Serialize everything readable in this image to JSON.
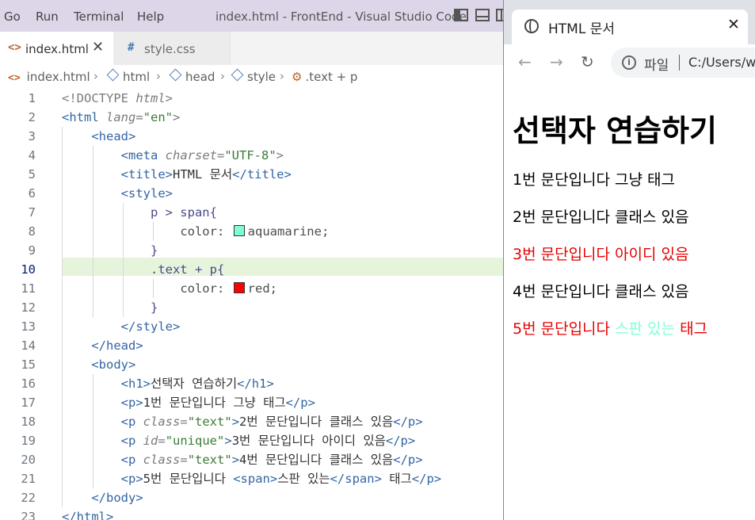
{
  "vscode": {
    "menu": [
      "Go",
      "Run",
      "Terminal",
      "Help"
    ],
    "window_title": "index.html - FrontEnd - Visual Studio Code",
    "tabs": [
      {
        "icon": "html-file-icon",
        "label": "index.html",
        "active": true
      },
      {
        "icon": "css-file-icon",
        "label": "style.css",
        "active": false
      }
    ],
    "breadcrumb": [
      "index.html",
      "html",
      "head",
      "style",
      ".text + p"
    ],
    "current_line": 10,
    "line_numbers": [
      "1",
      "2",
      "3",
      "4",
      "5",
      "6",
      "7",
      "8",
      "9",
      "10",
      "11",
      "12",
      "13",
      "14",
      "15",
      "16",
      "17",
      "18",
      "19",
      "20",
      "21",
      "22",
      "23"
    ],
    "code": {
      "doctype": "<!DOCTYPE",
      "doctype_html": "html",
      "html_open": "<html",
      "lang_attr": "lang",
      "lang_val": "\"en\"",
      "head_open": "<head>",
      "meta": "<meta",
      "charset_attr": "charset",
      "charset_val": "\"UTF-8\"",
      "title_open": "<title>",
      "title_text": "HTML 문서",
      "title_close": "</title>",
      "style_open": "<style>",
      "sel1": "p > span{",
      "prop": "color:",
      "val1": "aquamarine;",
      "val1_color": "#7fffd4",
      "brace_close": "}",
      "sel2": ".text + p{",
      "val2": "red;",
      "val2_color": "#ff0000",
      "style_close": "</style>",
      "head_close": "</head>",
      "body_open": "<body>",
      "h1_open": "<h1>",
      "h1_text": "선택자 연습하기",
      "h1_close": "</h1>",
      "p_open": "<p>",
      "p_close": "</p>",
      "p_tag": "<p",
      "class_attr": "class",
      "id_attr": "id",
      "text_val": "\"text\"",
      "unique_val": "\"unique\"",
      "p1_text": "1번 문단입니다 그냥 태그",
      "p2_text": "2번 문단입니다 클래스 있음",
      "p3_text": "3번 문단입니다 아이디 있음",
      "p4_text": "4번 문단입니다 클래스 있음",
      "p5_text_a": "5번 문단입니다 ",
      "span_open": "<span>",
      "span_text": "스판 있는",
      "span_close": "</span>",
      "p5_text_b": " 태그",
      "body_close": "</body>",
      "html_close": "</html>"
    }
  },
  "browser": {
    "tab_title": "HTML 문서",
    "omnibox_label": "파일",
    "url": "C:/Users/w",
    "page": {
      "h1": "선택자 연습하기",
      "p1": "1번 문단입니다 그냥 태그",
      "p2": "2번 문단입니다 클래스 있음",
      "p3": "3번 문단입니다 아이디 있음",
      "p4": "4번 문단입니다 클래스 있음",
      "p5_a": "5번 문단입니다 ",
      "p5_span": "스판 있는",
      "p5_b": " 태그"
    }
  }
}
